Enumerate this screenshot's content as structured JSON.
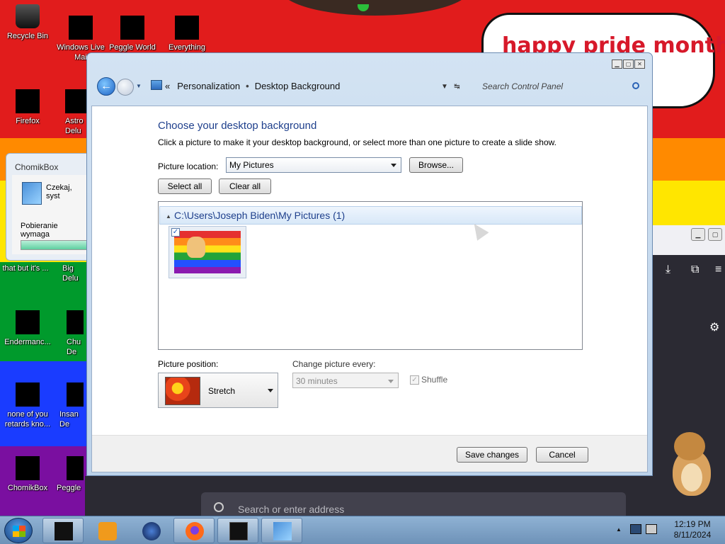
{
  "desktop": {
    "bubble_text": "happy pride month",
    "icons": [
      {
        "label": "Recycle Bin"
      },
      {
        "label": "Windows Live Mai"
      },
      {
        "label": "Peggle World"
      },
      {
        "label": "Everything"
      },
      {
        "label": "Firefox"
      },
      {
        "label": "Astro Delu"
      },
      {
        "label": "that but it's ..."
      },
      {
        "label": "Big Delu"
      },
      {
        "label": "Endermanc..."
      },
      {
        "label": "Chu De"
      },
      {
        "label": "none of you retards kno..."
      },
      {
        "label": "Insan De"
      },
      {
        "label": "ChomikBox"
      },
      {
        "label": "Peggle"
      }
    ]
  },
  "chomikbox": {
    "title": "ChomikBox",
    "status": "Czekaj, syst",
    "downloading": "Pobieranie wymaga"
  },
  "browser": {
    "address_placeholder": "Search or enter address"
  },
  "window": {
    "breadcrumb_lead": "«",
    "breadcrumb": [
      "Personalization",
      "Desktop Background"
    ],
    "breadcrumb_separator": "•",
    "search_placeholder": "Search Control Panel",
    "heading": "Choose your desktop background",
    "description": "Click a picture to make it your desktop background, or select more than one picture to create a slide show.",
    "picture_location_label": "Picture location:",
    "picture_location_value": "My Pictures",
    "browse_button": "Browse...",
    "select_all_button": "Select all",
    "clear_all_button": "Clear all",
    "group_header": "C:\\Users\\Joseph Biden\\My Pictures (1)",
    "picture_position_label": "Picture position:",
    "picture_position_value": "Stretch",
    "change_picture_label": "Change picture every:",
    "change_picture_value": "30 minutes",
    "shuffle_label": "Shuffle",
    "save_button": "Save changes",
    "cancel_button": "Cancel"
  },
  "taskbar": {
    "time": "12:19 PM",
    "date": "8/11/2024"
  }
}
